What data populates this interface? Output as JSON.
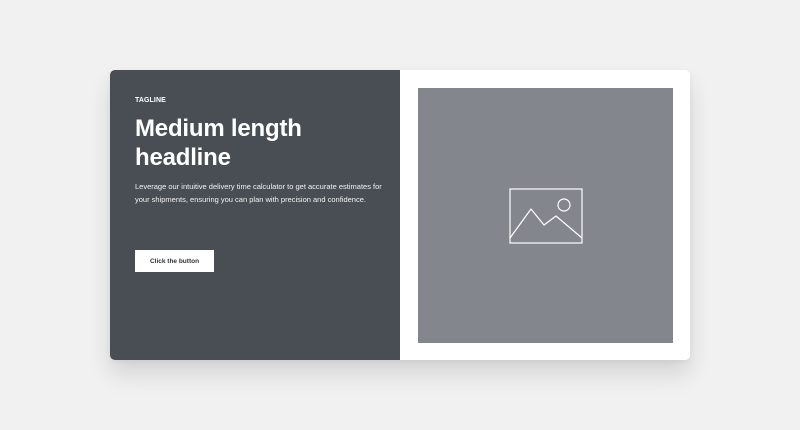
{
  "hero": {
    "tagline": "TAGLINE",
    "headline": "Medium length headline",
    "description": "Leverage our intuitive delivery time calculator to get accurate estimates for your shipments, ensuring you can plan with precision and confidence.",
    "button_label": "Click the button"
  },
  "media": {
    "icon": "image-placeholder-icon"
  },
  "colors": {
    "page_background": "#f1f1f1",
    "left_panel": "#484e54",
    "image_placeholder": "#83868d",
    "button_background": "#ffffff"
  }
}
